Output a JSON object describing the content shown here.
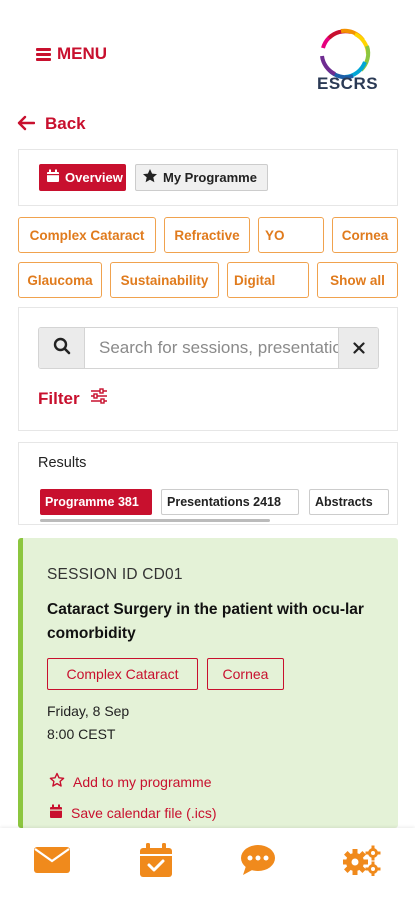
{
  "header": {
    "menu_label": "MENU",
    "logo_text": "ESCRS",
    "brand_color": "#c8102e"
  },
  "nav": {
    "back_label": "Back"
  },
  "view_tabs": {
    "overview_label": "Overview",
    "my_programme_label": "My Programme",
    "active": "Overview"
  },
  "topics": [
    "Complex Cataract",
    "Refractive",
    "YO",
    "Cornea",
    "Glaucoma",
    "Sustainability",
    "Digital",
    "Show all"
  ],
  "search": {
    "placeholder": "Search for sessions, presentations",
    "value": "",
    "filter_label": "Filter"
  },
  "results": {
    "label": "Results",
    "tabs": [
      {
        "label": "Programme 381",
        "active": true
      },
      {
        "label": "Presentations 2418",
        "active": false
      },
      {
        "label": "Abstracts",
        "active": false
      }
    ]
  },
  "session": {
    "id_label": "SESSION ID CD01",
    "title": "Cataract Surgery in the patient with ocu-lar comorbidity",
    "tags": [
      "Complex Cataract",
      "Cornea"
    ],
    "date": "Friday, 8 Sep",
    "time": "8:00 CEST",
    "add_label": "Add to my programme",
    "calendar_label": "Save calendar file (.ics)",
    "accent_color": "#8cc63f"
  },
  "bottom_nav": {
    "icons": [
      "mail-icon",
      "calendar-check-icon",
      "chat-icon",
      "settings-icon"
    ],
    "color": "#f08a1c"
  }
}
